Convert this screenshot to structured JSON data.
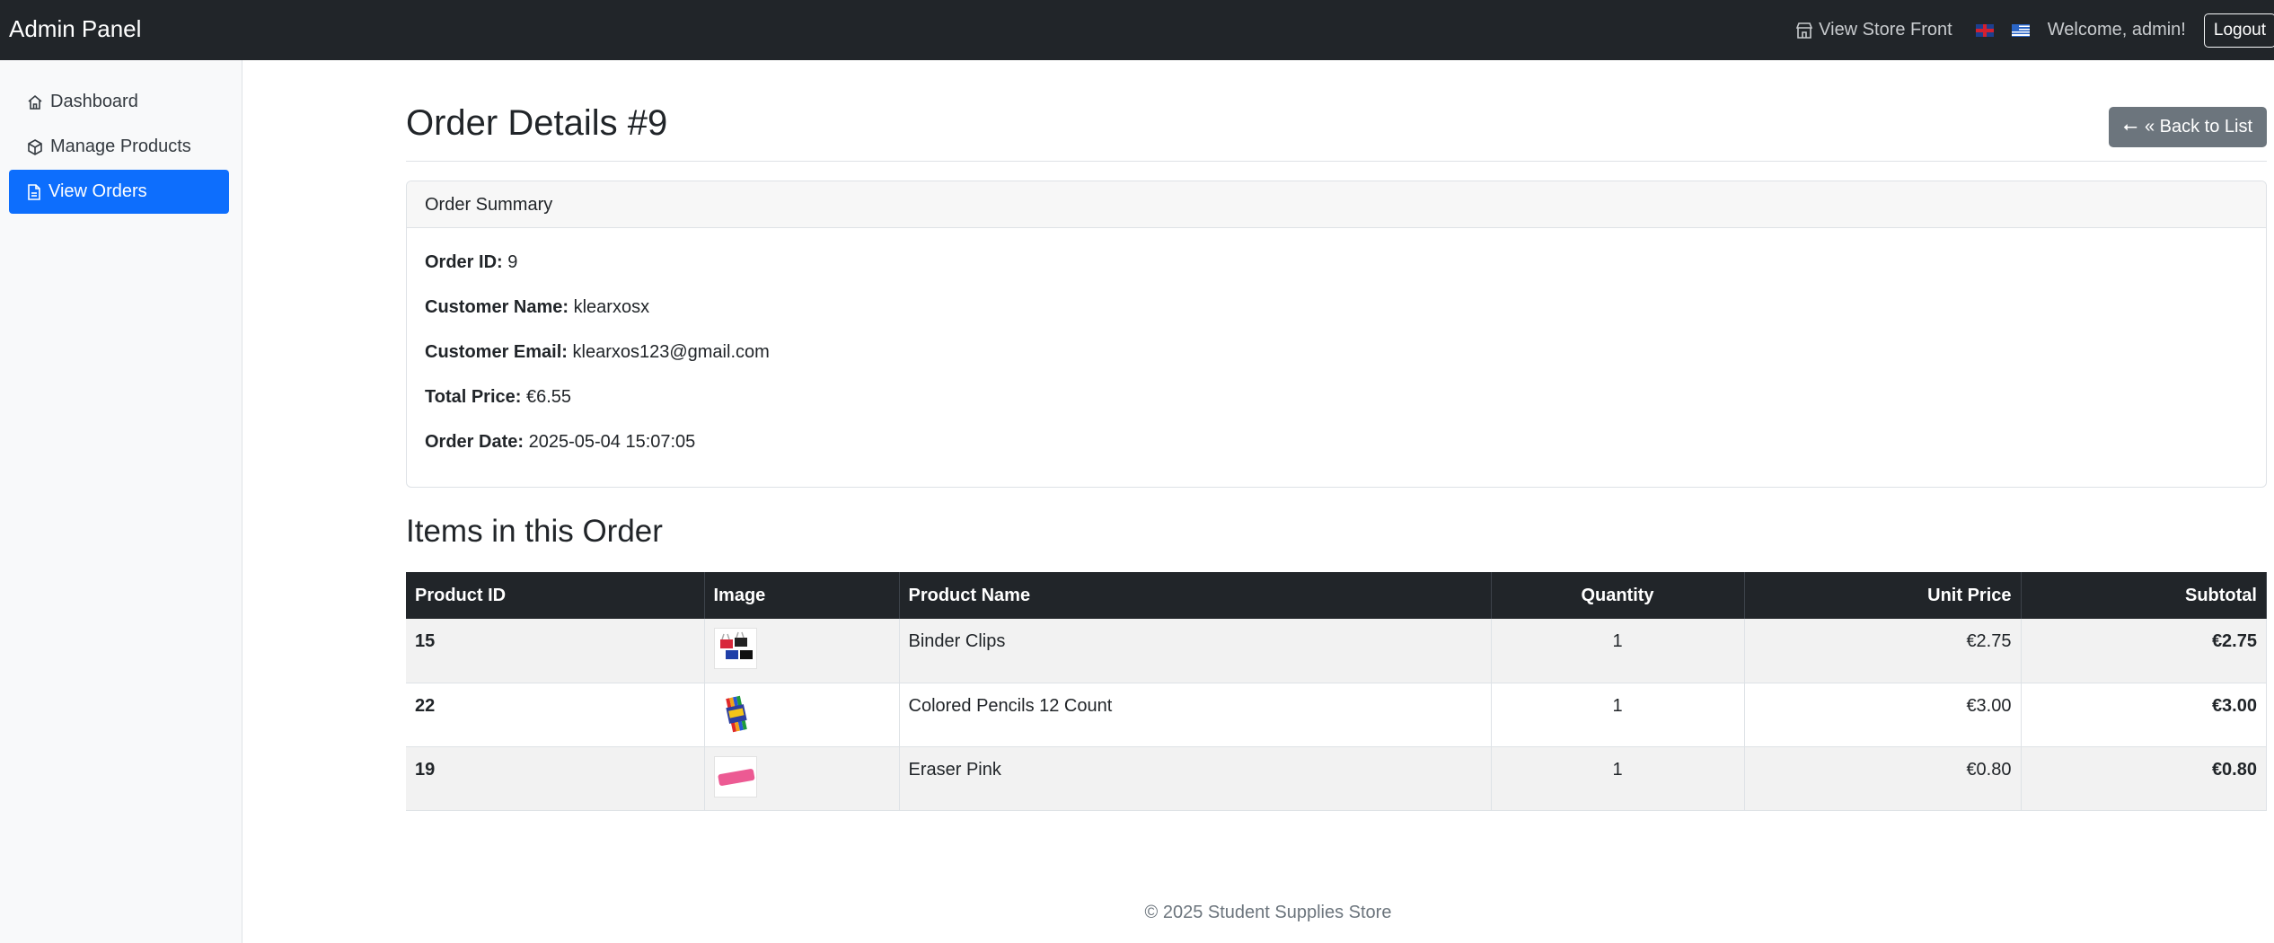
{
  "navbar": {
    "brand": "Admin Panel",
    "store_link": "View Store Front",
    "welcome": "Welcome, admin!",
    "logout": "Logout"
  },
  "sidebar": {
    "items": [
      {
        "label": "Dashboard",
        "icon": "home-icon"
      },
      {
        "label": "Manage Products",
        "icon": "box-icon"
      },
      {
        "label": "View Orders",
        "icon": "document-icon",
        "active": true
      }
    ]
  },
  "main": {
    "title": "Order Details #9",
    "back_button": "« Back to List",
    "summary": {
      "header": "Order Summary",
      "fields": [
        {
          "label": "Order ID:",
          "value": "9"
        },
        {
          "label": "Customer Name:",
          "value": "klearxosx"
        },
        {
          "label": "Customer Email:",
          "value": "klearxos123@gmail.com"
        },
        {
          "label": "Total Price:",
          "value": "€6.55"
        },
        {
          "label": "Order Date:",
          "value": "2025-05-04 15:07:05"
        }
      ]
    },
    "items_title": "Items in this Order",
    "table": {
      "headers": [
        "Product ID",
        "Image",
        "Product Name",
        "Quantity",
        "Unit Price",
        "Subtotal"
      ],
      "rows": [
        {
          "id": "15",
          "name": "Binder Clips",
          "qty": "1",
          "unit": "€2.75",
          "subtotal": "€2.75",
          "image": "binder-clips-thumbnail"
        },
        {
          "id": "22",
          "name": "Colored Pencils 12 Count",
          "qty": "1",
          "unit": "€3.00",
          "subtotal": "€3.00",
          "image": "colored-pencils-thumbnail"
        },
        {
          "id": "19",
          "name": "Eraser Pink",
          "qty": "1",
          "unit": "€0.80",
          "subtotal": "€0.80",
          "image": "eraser-thumbnail"
        }
      ]
    }
  },
  "footer": "© 2025 Student Supplies Store",
  "colors": {
    "navbar": "#212529",
    "active": "#0d6efd",
    "back_button": "#6c757d"
  }
}
